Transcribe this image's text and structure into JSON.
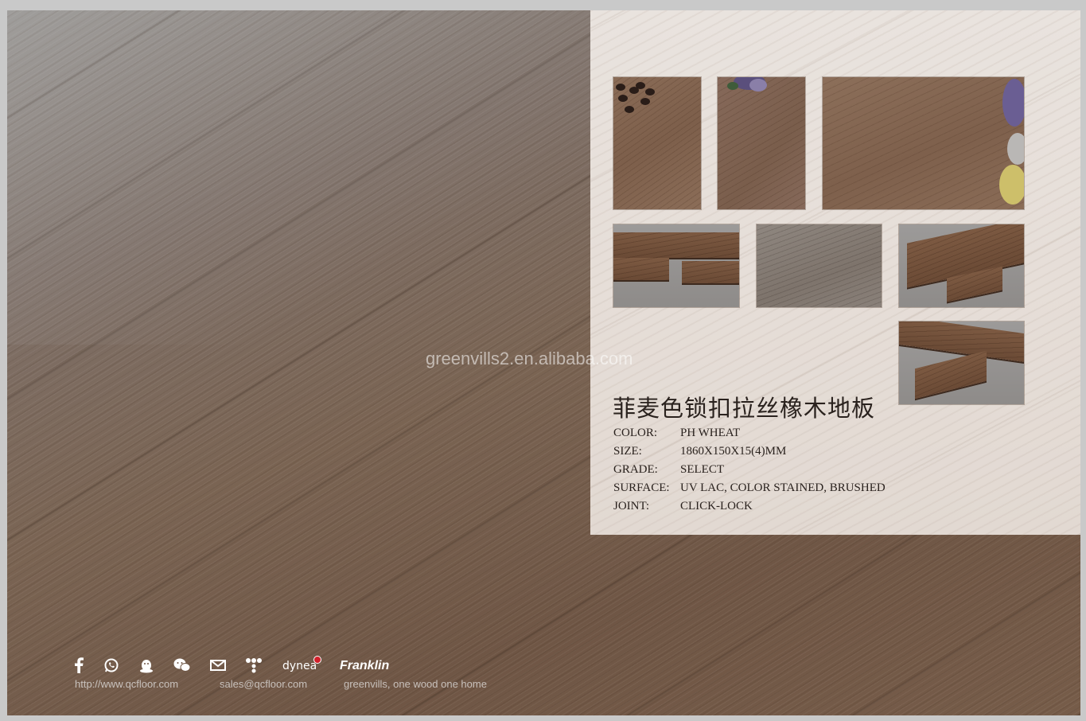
{
  "watermark": "greenvills2.en.alibaba.com",
  "product": {
    "title_cn": "菲麦色锁扣拉丝橡木地板",
    "specs": [
      {
        "label": "COLOR:",
        "value": "PH WHEAT"
      },
      {
        "label": "SIZE:",
        "value": "1860X150X15(4)MM"
      },
      {
        "label": "GRADE:",
        "value": "SELECT"
      },
      {
        "label": "SURFACE:",
        "value": "UV LAC, COLOR STAINED, BRUSHED"
      },
      {
        "label": "JOINT:",
        "value": "CLICK-LOCK"
      }
    ]
  },
  "footer": {
    "icons": [
      "facebook-icon",
      "whatsapp-icon",
      "qq-icon",
      "wechat-icon",
      "mail-icon",
      "network-icon"
    ],
    "website": "http://www.qcfloor.com",
    "email": "sales@qcfloor.com",
    "slogan": "greenvills, one wood one home",
    "brands": {
      "dynea": "dynea",
      "franklin": "Franklin"
    }
  },
  "colors": {
    "brand_red": "#d2202a",
    "panel_bg": "#e6ded8",
    "text_dark": "#2a221e"
  }
}
